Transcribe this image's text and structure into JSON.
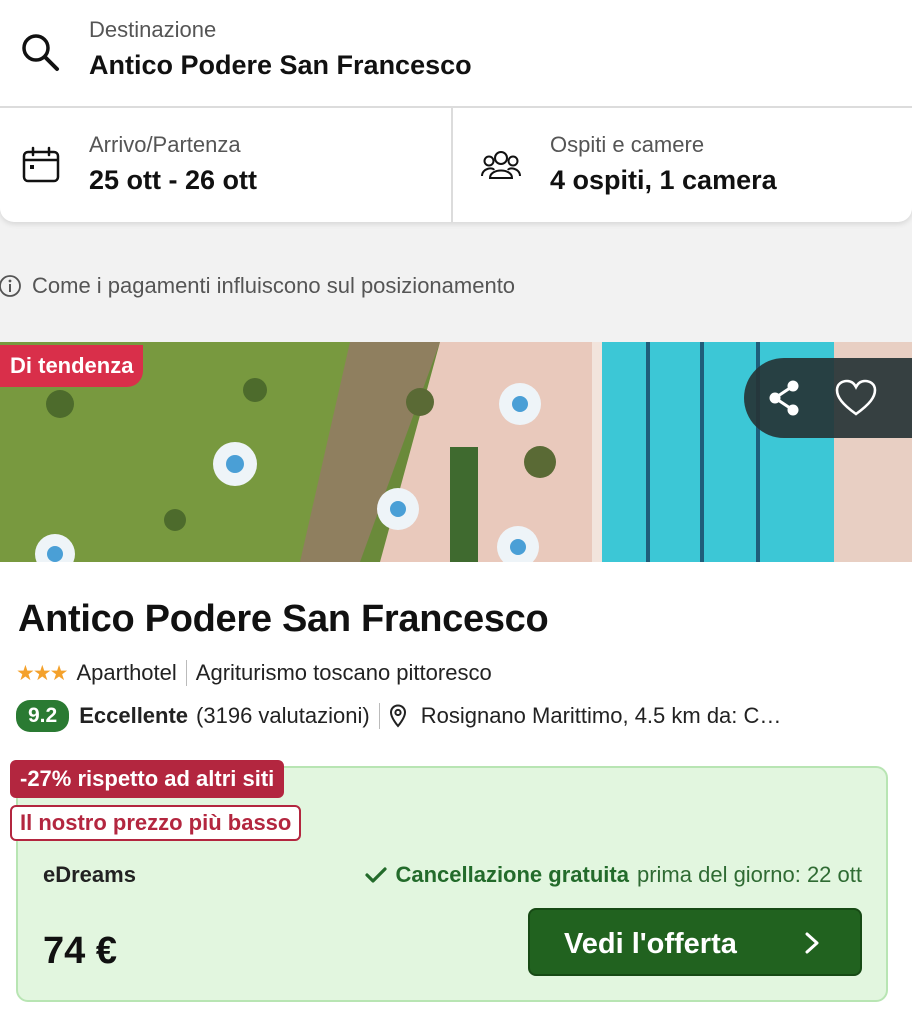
{
  "search": {
    "destination_label": "Destinazione",
    "destination_value": "Antico Podere San Francesco",
    "dates_label": "Arrivo/Partenza",
    "dates_value": "25 ott - 26 ott",
    "guests_label": "Ospiti e camere",
    "guests_value": "4 ospiti, 1 camera"
  },
  "ranking_info": "Come i pagamenti influiscono sul posizionamento",
  "hotel": {
    "trend_badge": "Di tendenza",
    "name": "Antico Podere San Francesco",
    "stars": 3,
    "stars_glyphs": "★★★",
    "type": "Aparthotel",
    "description": "Agriturismo toscano pittoresco",
    "score": "9.2",
    "rating_word": "Eccellente",
    "reviews": "(3196 valutazioni)",
    "location": "Rosignano Marittimo, 4.5 km da: C…"
  },
  "deal": {
    "discount_badge": "-27% rispetto ad altri siti",
    "price_badge": "Il nostro prezzo più basso",
    "provider": "eDreams",
    "cancellation_strong": "Cancellazione gratuita",
    "cancellation_note": "prima del giorno: 22 ott",
    "price": "74 €",
    "cta_label": "Vedi l'offerta"
  },
  "colors": {
    "trend_badge": "#d92f4a",
    "score_badge": "#2a7a32",
    "discount_badge": "#b3263f",
    "deal_bg": "#e2f6df",
    "cta_bg": "#21621f",
    "stars": "#f4a12b"
  },
  "icons": [
    "search-icon",
    "calendar-icon",
    "guests-icon",
    "info-icon",
    "share-icon",
    "heart-icon",
    "location-pin-icon",
    "check-icon",
    "chevron-right-icon"
  ]
}
